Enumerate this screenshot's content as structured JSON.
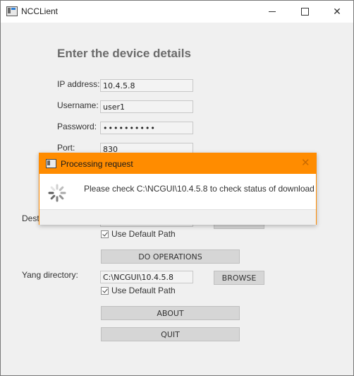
{
  "window": {
    "title": "NCCLient",
    "controls": [
      "minimize-icon",
      "maximize-icon",
      "close-icon"
    ]
  },
  "form": {
    "heading": "Enter the device details",
    "ip_label": "IP address:",
    "ip_value": "10.4.5.8",
    "username_label": "Username:",
    "username_value": "user1",
    "password_label": "Password:",
    "password_value": "••••••••••",
    "port_label": "Port:",
    "port_value": "830",
    "destination_label_partial": "Desti",
    "destination_use_default": "Use Default Path",
    "do_operations": "DO OPERATIONS",
    "yang_label": "Yang directory:",
    "yang_value": "C:\\NCGUI\\10.4.5.8",
    "browse": "BROWSE",
    "yang_use_default": "Use Default Path",
    "about": "ABOUT",
    "quit": "QUIT"
  },
  "dialog": {
    "title": "Processing request",
    "message": "Please check C:\\NCGUI\\10.4.5.8 to check status of download",
    "accent_color": "#ff8c00"
  }
}
